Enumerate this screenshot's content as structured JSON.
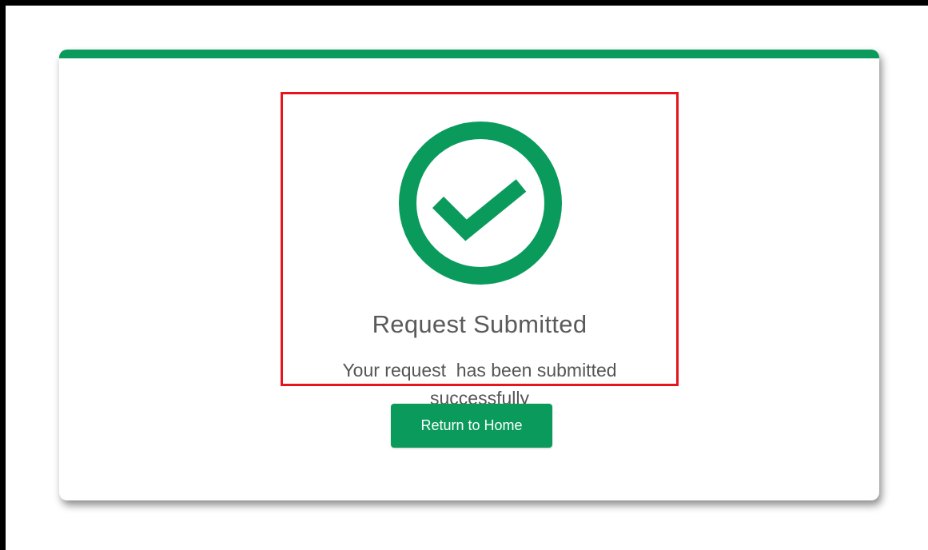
{
  "colors": {
    "accent": "#0a9b5c",
    "highlight_border": "#e8141b",
    "text": "#5a5a5a"
  },
  "confirmation": {
    "icon": "check-circle-icon",
    "title": "Request Submitted",
    "message": "Your request  has been submitted\nsuccessfully"
  },
  "actions": {
    "home_label": "Return to Home"
  }
}
